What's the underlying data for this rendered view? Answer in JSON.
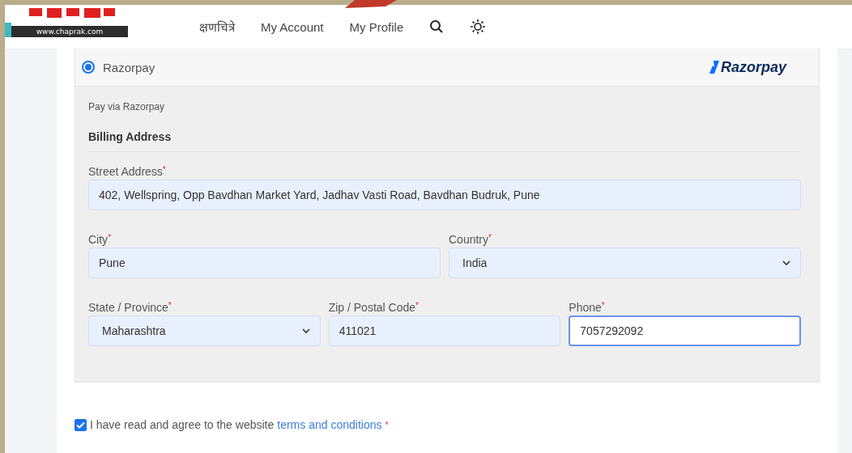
{
  "header": {
    "logo_url": "www.chaprak.com",
    "nav": [
      {
        "label": "क्षणचित्रे"
      },
      {
        "label": "My Account"
      },
      {
        "label": "My Profile"
      }
    ]
  },
  "payment": {
    "method": {
      "label": "Razorpay",
      "selected": true
    },
    "brand": "Razorpay",
    "description": "Pay via Razorpay",
    "section_title": "Billing Address",
    "fields": [
      {
        "label": "Street Address",
        "required_mark": "*",
        "value": "402, Wellspring, Opp Bavdhan Market Yard, Jadhav Vasti Road, Bavdhan Budruk, Pune",
        "kind": "text",
        "focused": false
      },
      {
        "label": "City",
        "required_mark": "*",
        "value": "Pune",
        "kind": "text",
        "focused": false
      },
      {
        "label": "Country",
        "required_mark": "*",
        "value": "India",
        "kind": "select",
        "focused": false
      },
      {
        "label": "State / Province",
        "required_mark": "*",
        "value": "Maharashtra",
        "kind": "select",
        "focused": false
      },
      {
        "label": "Zip / Postal Code",
        "required_mark": "*",
        "value": "411021",
        "kind": "text",
        "focused": false
      },
      {
        "label": "Phone",
        "required_mark": "*",
        "value": "7057292092",
        "kind": "text",
        "focused": true
      }
    ]
  },
  "terms": {
    "checked": true,
    "text": "I have read and agree to the website",
    "link": "terms and conditions",
    "required_mark": "*"
  }
}
